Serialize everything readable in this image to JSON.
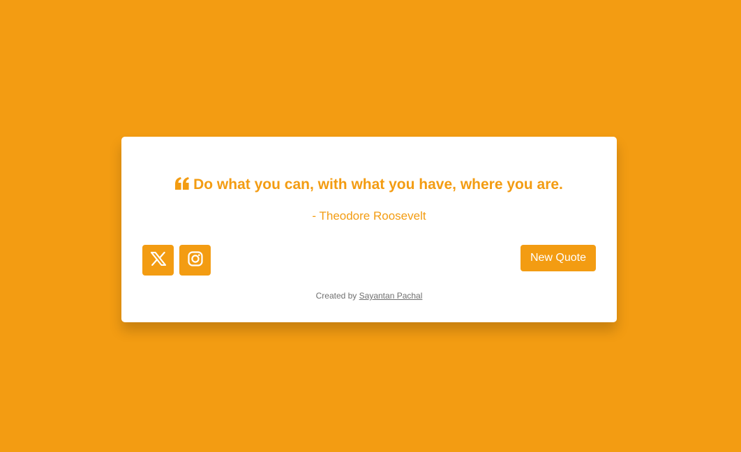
{
  "theme": {
    "accent": "#f39c12",
    "card_background": "#ffffff",
    "footer_text_color": "#6f6f6f"
  },
  "quote": {
    "icon": "quote-left-icon",
    "text": "Do what you can, with what you have, where you are.",
    "author": "- Theodore Roosevelt"
  },
  "social": {
    "buttons": [
      {
        "icon": "x-twitter-icon"
      },
      {
        "icon": "instagram-icon"
      }
    ]
  },
  "actions": {
    "new_quote_label": "New Quote"
  },
  "footer": {
    "prefix": "Created by",
    "author_link": "Sayantan Pachal"
  }
}
